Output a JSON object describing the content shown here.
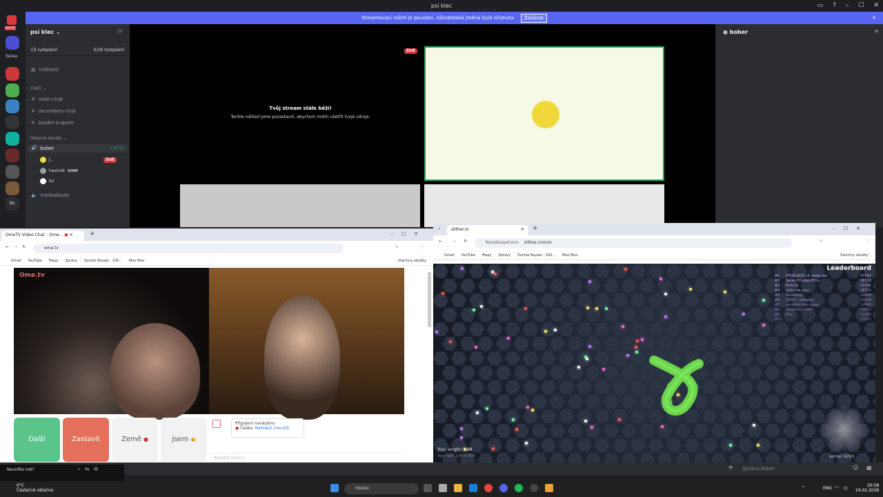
{
  "discord": {
    "window_title": "psí klec",
    "banner_text": "Streamovací režim je povolen. Uživatelská jména byla ořiznuta.",
    "banner_button": "Zakázat",
    "server_name": "psí klec",
    "boost_label": "Cíl vylepšení",
    "boost_progress": "0/28 Vylepšení",
    "events_label": "Události",
    "chat_category": "CHAT",
    "text_channels": [
      "main-chat",
      "secondary-chat",
      "bordel-a-spam"
    ],
    "voice_category": "Hlasové kanály",
    "voice_channel_1": "bober",
    "voice_duration": "1:00:51",
    "voice_users": [
      {
        "name": "J...",
        "color": "#e8d84a"
      },
      {
        "name": "haxicek",
        "tag": "GOAT",
        "color": "#9aa0a6"
      },
      {
        "name": "lul",
        "color": "#ffffff"
      }
    ],
    "voice_channel_2": "rumbakoule",
    "live_badge": "ŽIVĚ",
    "stream_msg_title": "Tvůj stream stále běží!",
    "stream_msg_body": "Tenhle náhled jsme pozastavili, abychom mohli ušetřit tvoje zdroje.",
    "right_panel_title": "bober",
    "server_labels": [
      "NOVÉ",
      "TaGiGo",
      "Dc"
    ],
    "accent": "#5865f2"
  },
  "ome_window": {
    "tab_title": "OmeTV Video Chat – Ome...",
    "url": "ome.tv",
    "bookmarks": [
      "Gmail",
      "YouTube",
      "Mapy",
      "Zprávy",
      "Zombs Royale - 100...",
      "Moo Moo"
    ],
    "all_bookmarks": "Všechny záložky",
    "logo": "Ome.tv",
    "btn_next": "Další",
    "btn_stop": "Zastavit",
    "btn_country": "Země",
    "btn_me": "Jsem",
    "status_1": "Připojení navázáno.",
    "status_2": "Česko.",
    "status_report": "Nahlásit zneužití",
    "chat_placeholder": "Napište zprávu"
  },
  "slither_window": {
    "tab_title": "slither.io",
    "url_warning": "Nezabezpečeno",
    "url": "slither.com/io",
    "bookmarks": [
      "Gmail",
      "YouTube",
      "Mapy",
      "Zprávy",
      "Zombs Royale - 100...",
      "Moo Moo"
    ],
    "all_bookmarks": "Všechny záložky",
    "leaderboard_title": "Leaderboard",
    "leaderboard": [
      {
        "rank": "#1",
        "name": "[FR]BLACK| IX never die",
        "score": "37507"
      },
      {
        "rank": "#2",
        "name": "Sarah P.Dallas FB1+",
        "score": "29138"
      },
      {
        "rank": "#3",
        "name": "Bellicia",
        "score": "22101"
      },
      {
        "rank": "#4",
        "name": "utiliz me your",
        "score": "16315"
      },
      {
        "rank": "#5",
        "name": "Nerdborg",
        "score": "14893"
      },
      {
        "rank": "#6",
        "name": "[DEP] ~soloplay",
        "score": "13218"
      },
      {
        "rank": "#7",
        "name": "ya Ahhh then bana",
        "score": "12845"
      },
      {
        "rank": "#8",
        "name": "tessa-Paris.com",
        "score": "12601"
      },
      {
        "rank": "#9",
        "name": "Moo",
        "score": "11980"
      },
      {
        "rank": "#10",
        "name": "",
        "score": "10921"
      }
    ],
    "length_label": "Your length:",
    "length_value": "220",
    "rank_label": "Your rank:",
    "rank_value": "178 of 608",
    "server_label": "server 4263"
  },
  "bottom": {
    "message_placeholder": "Zpráva bober"
  },
  "taskbar": {
    "weather_temp": "0°C",
    "weather_desc": "Částečně oblačno",
    "search_placeholder": "Hledat",
    "lang": "ENG",
    "time": "20:58",
    "date": "24.02.2026",
    "unmute_label": "Nevidíte mě?"
  }
}
